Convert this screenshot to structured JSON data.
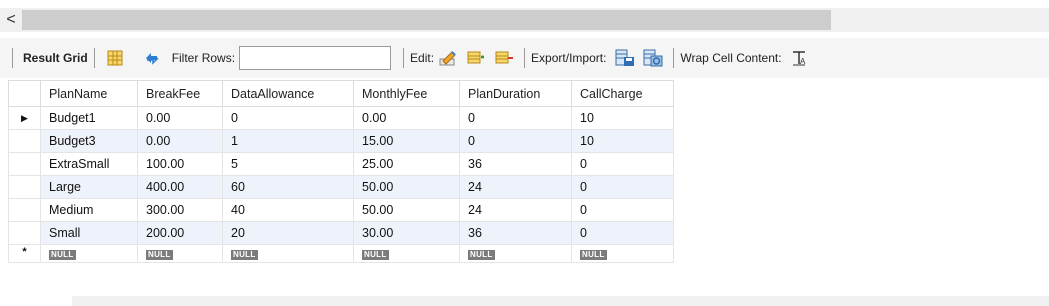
{
  "scroll": {
    "left_arrow": "<"
  },
  "toolbar": {
    "result_grid": "Result Grid",
    "filter_rows": "Filter Rows:",
    "filter_value": "",
    "edit": "Edit:",
    "export_import": "Export/Import:",
    "wrap_cell_content": "Wrap Cell Content:"
  },
  "grid": {
    "columns": [
      "PlanName",
      "BreakFee",
      "DataAllowance",
      "MonthlyFee",
      "PlanDuration",
      "CallCharge"
    ],
    "rows": [
      [
        "Budget1",
        "0.00",
        "0",
        "0.00",
        "0",
        "10"
      ],
      [
        "Budget3",
        "0.00",
        "1",
        "15.00",
        "0",
        "10"
      ],
      [
        "ExtraSmall",
        "100.00",
        "5",
        "25.00",
        "36",
        "0"
      ],
      [
        "Large",
        "400.00",
        "60",
        "50.00",
        "24",
        "0"
      ],
      [
        "Medium",
        "300.00",
        "40",
        "50.00",
        "24",
        "0"
      ],
      [
        "Small",
        "200.00",
        "20",
        "30.00",
        "36",
        "0"
      ]
    ],
    "null_label": "NULL",
    "current_row_marker": "▶",
    "new_row_marker": "*"
  }
}
